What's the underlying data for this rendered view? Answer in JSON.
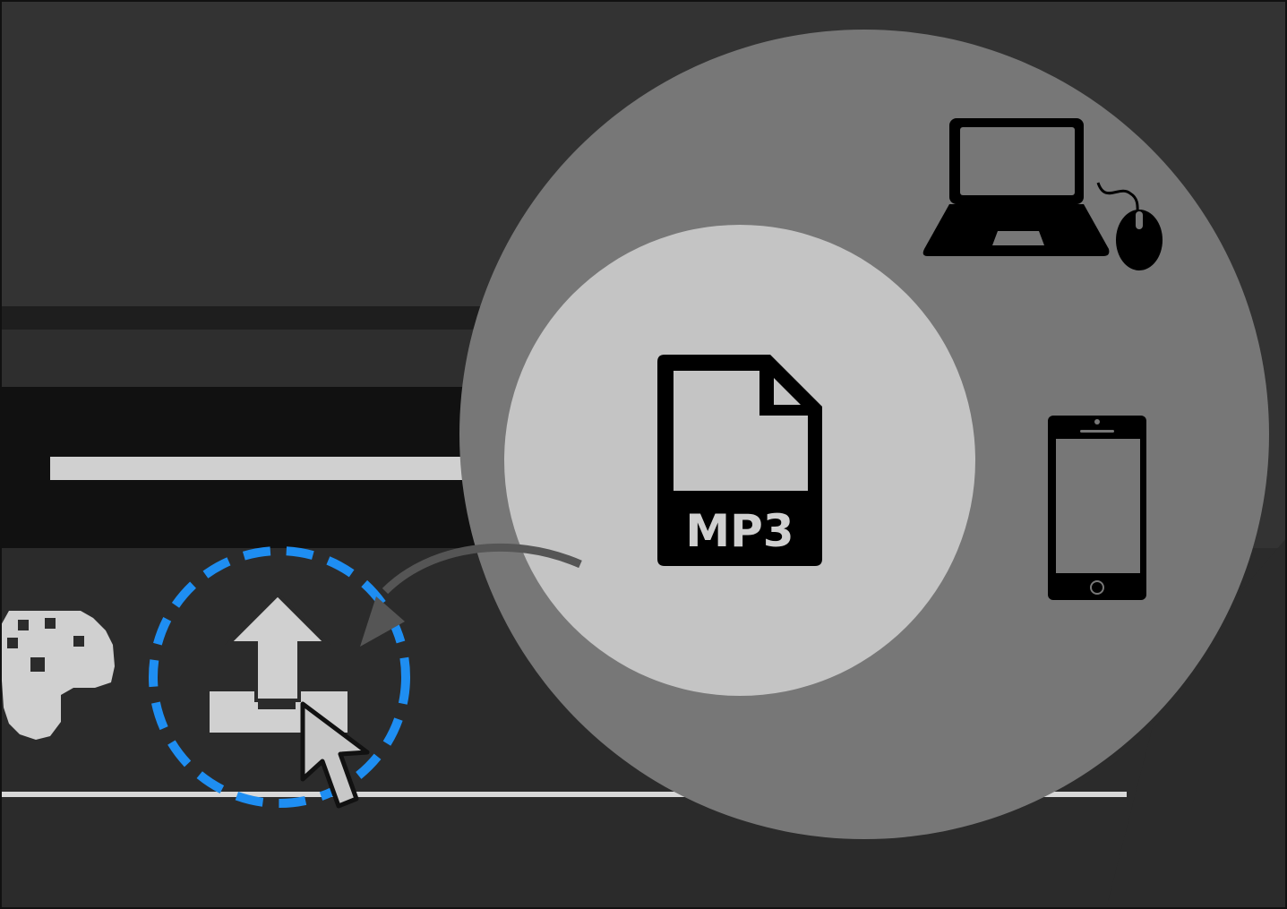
{
  "file_badge": {
    "format_label": "MP3",
    "icon": "audio-file-icon"
  },
  "toolbar": {
    "buttons": [
      {
        "name": "theme-palette-button",
        "icon": "palette-icon"
      },
      {
        "name": "export-button",
        "icon": "upload-icon",
        "highlighted": true
      }
    ]
  },
  "targets": [
    {
      "name": "computer",
      "icon": "laptop-icon"
    },
    {
      "name": "mouse",
      "icon": "mouse-icon"
    },
    {
      "name": "phone",
      "icon": "smartphone-icon"
    }
  ],
  "colors": {
    "background": "#333333",
    "panel_dark": "#111111",
    "panel_mid": "#2b2b2b",
    "zoom_outer": "#777777",
    "zoom_inner": "#c4c4c4",
    "highlight_ring": "#1e8ef2",
    "icon_fill": "#d0d0d0",
    "ink": "#000000"
  }
}
